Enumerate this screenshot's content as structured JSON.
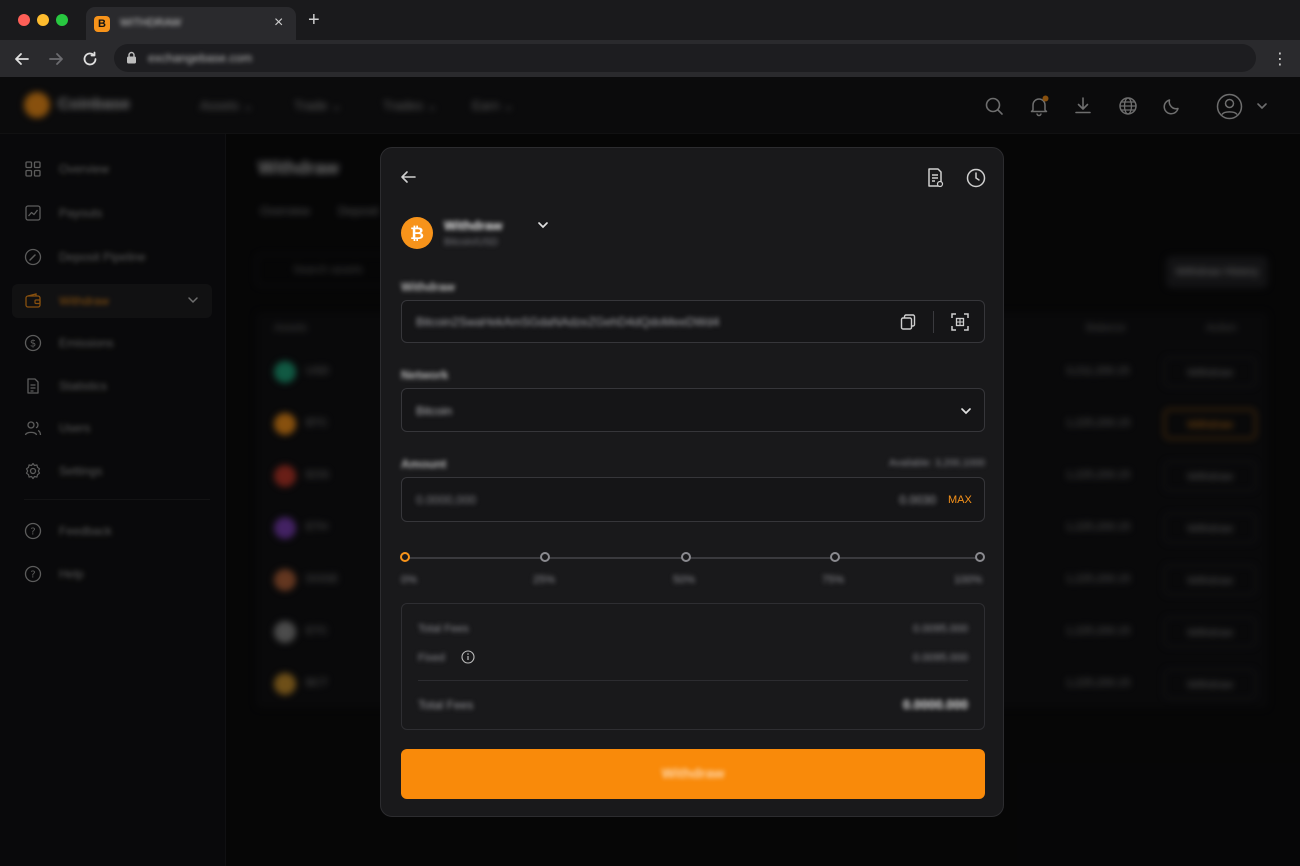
{
  "browser": {
    "tab_title": "WITHDRAW",
    "tab_favicon": "B",
    "url": "exchangebase.com"
  },
  "app": {
    "brand": "Coinbase",
    "nav": [
      "Assets",
      "Trade",
      "Trades",
      "Earn"
    ]
  },
  "sidebar": {
    "items": [
      {
        "label": "Overview",
        "icon": "grid-icon"
      },
      {
        "label": "Payouts",
        "icon": "chart-icon"
      },
      {
        "label": "Deposit Pipeline",
        "icon": "gauge-icon"
      },
      {
        "label": "Withdraw",
        "icon": "wallet-icon",
        "active": true
      },
      {
        "label": "Emissions",
        "icon": "dollar-icon"
      },
      {
        "label": "Statistics",
        "icon": "document-icon"
      },
      {
        "label": "Users",
        "icon": "users-icon"
      },
      {
        "label": "Settings",
        "icon": "gear-icon"
      }
    ],
    "footer_items": [
      {
        "label": "Feedback",
        "icon": "question-icon"
      },
      {
        "label": "Help",
        "icon": "help-icon"
      }
    ]
  },
  "background_page": {
    "title": "Withdraw",
    "tabs": [
      "Overview",
      "Deposit"
    ],
    "search_placeholder": "Search assets",
    "action_button": "Withdraw History",
    "columns": [
      "Assets",
      "Balance",
      "Action"
    ],
    "rows": [
      {
        "asset": "USD",
        "balance": "3,211,200.15",
        "action": "Withdraw",
        "color": "#1fa37a"
      },
      {
        "asset": "BTC",
        "balance": "1,225,200.15",
        "action": "Withdraw",
        "color": "#f7931a",
        "highlight": true
      },
      {
        "asset": "EOS",
        "balance": "1,225,200.15",
        "action": "Withdraw",
        "color": "#c0392b"
      },
      {
        "asset": "ETH",
        "balance": "1,225,200.15",
        "action": "Withdraw",
        "color": "#7b3fb5"
      },
      {
        "asset": "DOGE",
        "balance": "1,225,200.15",
        "action": "Withdraw",
        "color": "#b5643b"
      },
      {
        "asset": "ETC",
        "balance": "1,225,200.15",
        "action": "Withdraw",
        "color": "#8a8a8a"
      },
      {
        "asset": "BCT",
        "balance": "1,225,200.15",
        "action": "Withdraw",
        "color": "#c9912d"
      }
    ]
  },
  "modal": {
    "coin_name": "Withdraw",
    "coin_sub": "Bitcoin/USD",
    "address_label": "Withdraw",
    "address_value": "Bitcoin2SwaHekAmSGdaNAdzeZGehD4dQdoMeeDWd4",
    "network_label": "Network",
    "network_value": "Bitcoin",
    "amount_label": "Amount",
    "available": "Available: 3,200,1000",
    "amount_placeholder": "0.0000,000",
    "amount_fee": "0.0030",
    "max_label": "MAX",
    "percent_marks": [
      "0%",
      "25%",
      "50%",
      "75%",
      "100%"
    ],
    "selected_percent": 0,
    "summary": {
      "row1_label": "Total Fees",
      "row1_value": "0.0095.000",
      "row2_label": "Fixed",
      "row2_value": "0.0095.000",
      "total_label": "Total Fees",
      "total_value": "0.0000.000"
    },
    "submit_label": "Withdraw"
  },
  "colors": {
    "accent": "#f7931a",
    "button": "#f98a0a",
    "notification_dot": "#f7931a"
  }
}
